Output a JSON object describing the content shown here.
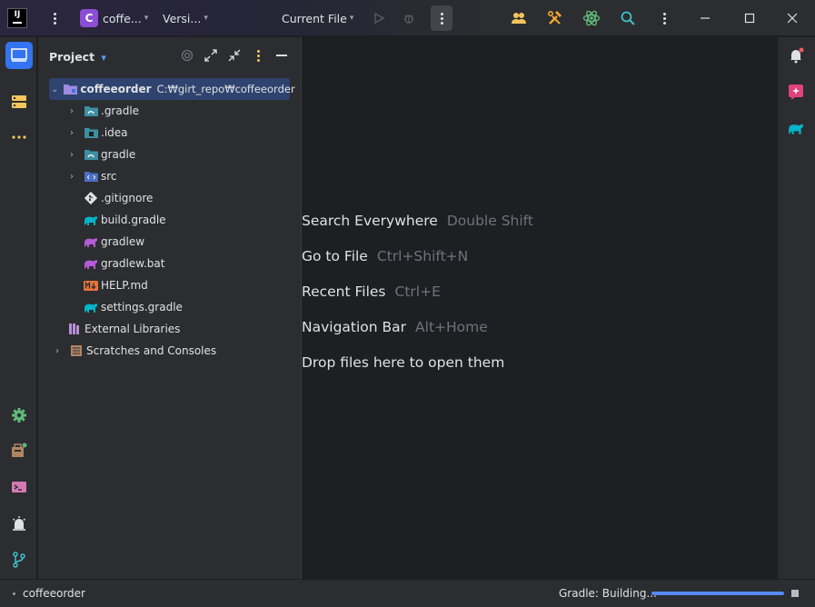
{
  "titlebar": {
    "project_badge": "C",
    "project_name": "coffe...",
    "vcs_label": "Versi...",
    "run_config": "Current File"
  },
  "project_panel": {
    "title": "Project",
    "tree": [
      {
        "label": "coffeeorder",
        "path": "C:₩girt_repo₩coffeeorder",
        "icon": "module-folder-icon"
      },
      {
        "label": ".gradle",
        "icon": "gradle-folder-icon"
      },
      {
        "label": ".idea",
        "icon": "idea-folder-icon"
      },
      {
        "label": "gradle",
        "icon": "gradle-folder-icon"
      },
      {
        "label": "src",
        "icon": "source-folder-icon"
      },
      {
        "label": ".gitignore",
        "icon": "git-file-icon"
      },
      {
        "label": "build.gradle",
        "icon": "gradle-elephant-icon"
      },
      {
        "label": "gradlew",
        "icon": "gradlew-elephant-icon"
      },
      {
        "label": "gradlew.bat",
        "icon": "gradlew-elephant-icon"
      },
      {
        "label": "HELP.md",
        "icon": "markdown-icon"
      },
      {
        "label": "settings.gradle",
        "icon": "gradle-elephant-icon"
      },
      {
        "label": "External Libraries",
        "icon": "library-icon"
      },
      {
        "label": "Scratches and Consoles",
        "icon": "scratches-icon"
      }
    ]
  },
  "editor_hints": [
    {
      "action": "Search Everywhere",
      "shortcut": "Double Shift"
    },
    {
      "action": "Go to File",
      "shortcut": "Ctrl+Shift+N"
    },
    {
      "action": "Recent Files",
      "shortcut": "Ctrl+E"
    },
    {
      "action": "Navigation Bar",
      "shortcut": "Alt+Home"
    },
    {
      "action": "Drop files here to open them",
      "shortcut": ""
    }
  ],
  "statusbar": {
    "project": "coffeeorder",
    "gradle_status": "Gradle: Building...",
    "progress": 1.0
  },
  "colors": {
    "accent": "#3574f0",
    "selection": "#2e436e",
    "gradle": "#02b5c8",
    "gradlew": "#b45bd6",
    "markdown": "#e8743b"
  }
}
